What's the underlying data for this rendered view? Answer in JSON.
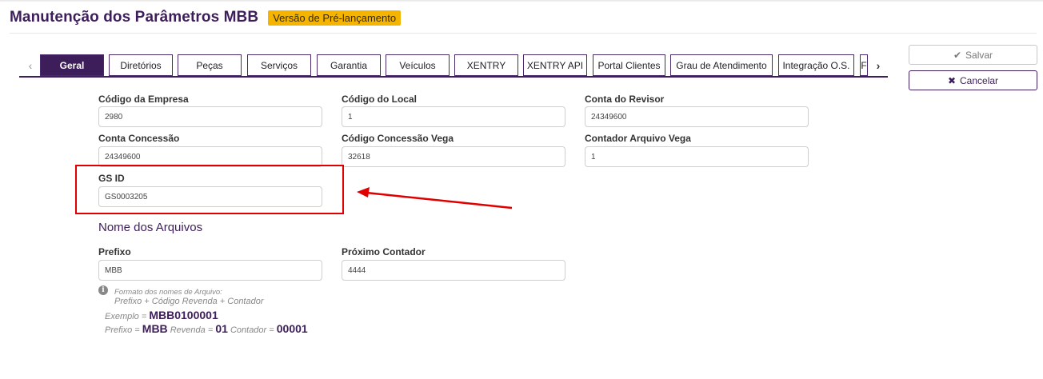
{
  "header": {
    "title": "Manutenção dos Parâmetros MBB",
    "badge": "Versão de Pré-lançamento"
  },
  "tabs": [
    {
      "label": "Geral",
      "active": true
    },
    {
      "label": "Diretórios"
    },
    {
      "label": "Peças"
    },
    {
      "label": "Serviços"
    },
    {
      "label": "Garantia"
    },
    {
      "label": "Veículos"
    },
    {
      "label": "XENTRY"
    },
    {
      "label": "XENTRY API"
    },
    {
      "label": "Portal Clientes"
    },
    {
      "label": "Grau de Atendimento"
    },
    {
      "label": "Integração O.S."
    },
    {
      "label": "F"
    }
  ],
  "actions": {
    "save": "Salvar",
    "cancel": "Cancelar"
  },
  "fields": {
    "codigo_empresa": {
      "label": "Código da Empresa",
      "value": "2980"
    },
    "codigo_local": {
      "label": "Código do Local",
      "value": "1"
    },
    "conta_revisor": {
      "label": "Conta do Revisor",
      "value": "24349600"
    },
    "conta_concessao": {
      "label": "Conta Concessão",
      "value": "24349600"
    },
    "codigo_concessao_vega": {
      "label": "Código Concessão Vega",
      "value": "32618"
    },
    "contador_arquivo_vega": {
      "label": "Contador Arquivo Vega",
      "value": "1"
    },
    "gs_id": {
      "label": "GS ID",
      "value": "GS0003205"
    }
  },
  "arquivos": {
    "section_title": "Nome dos Arquivos",
    "prefixo": {
      "label": "Prefixo",
      "value": "MBB"
    },
    "proximo_contador": {
      "label": "Próximo Contador",
      "value": "4444"
    },
    "hint_title": "Formato dos nomes de Arquivo:",
    "hint_format": "Prefixo + Código Revenda + Contador",
    "exemplo_label": "Exemplo =",
    "exemplo_value": "MBB0100001",
    "prefixo_label": "Prefixo =",
    "prefixo_value": "MBB",
    "revenda_label": "Revenda =",
    "revenda_value": "01",
    "contador_label": "Contador =",
    "contador_value": "00001"
  },
  "annotation": {
    "color": "#e00000"
  }
}
